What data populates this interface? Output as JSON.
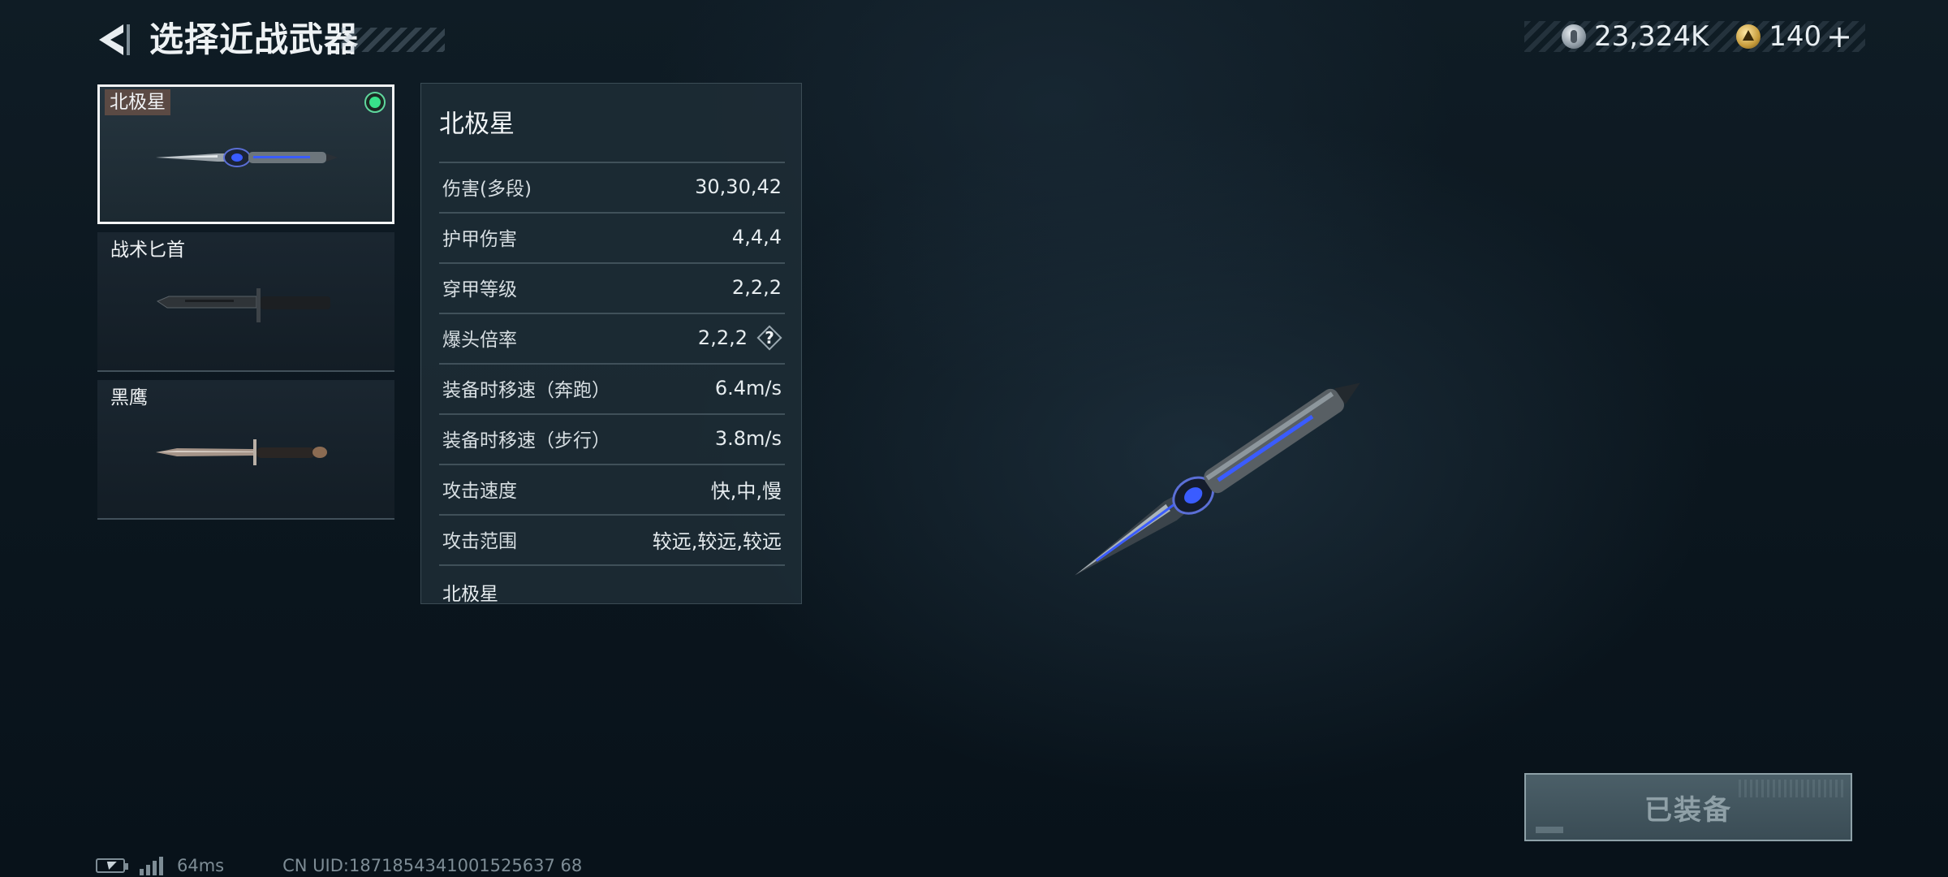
{
  "header": {
    "title": "选择近战武器",
    "back_icon": "back-arrow-icon"
  },
  "currency": {
    "silver": {
      "icon": "silver-coin-icon",
      "value": "23,324K"
    },
    "gold": {
      "icon": "gold-coin-icon",
      "value": "140"
    },
    "plus_label": "+"
  },
  "weapons": [
    {
      "name": "北极星",
      "selected": true,
      "equipped": true
    },
    {
      "name": "战术匕首",
      "selected": false,
      "equipped": false
    },
    {
      "name": "黑鹰",
      "selected": false,
      "equipped": false
    }
  ],
  "stats": {
    "title": "北极星",
    "rows": [
      {
        "label": "伤害(多段)",
        "value": "30,30,42"
      },
      {
        "label": "护甲伤害",
        "value": "4,4,4"
      },
      {
        "label": "穿甲等级",
        "value": "2,2,2"
      },
      {
        "label": "爆头倍率",
        "value": "2,2,2"
      },
      {
        "label": "装备时移速（奔跑）",
        "value": "6.4m/s"
      },
      {
        "label": "装备时移速（步行）",
        "value": "3.8m/s"
      },
      {
        "label": "攻击速度",
        "value": "快,中,慢"
      },
      {
        "label": "攻击范围",
        "value": "较远,较远,较远"
      }
    ],
    "help_glyph": "?",
    "footer": "北极星"
  },
  "equip_button": {
    "label": "已装备"
  },
  "status": {
    "ping": "64ms",
    "uid": "CN UID:1871854341001525637 68"
  },
  "colors": {
    "equipped_indicator": "#38e28a",
    "selected_border": "#f2f5f6",
    "blade_accent": "#3a5cff"
  }
}
